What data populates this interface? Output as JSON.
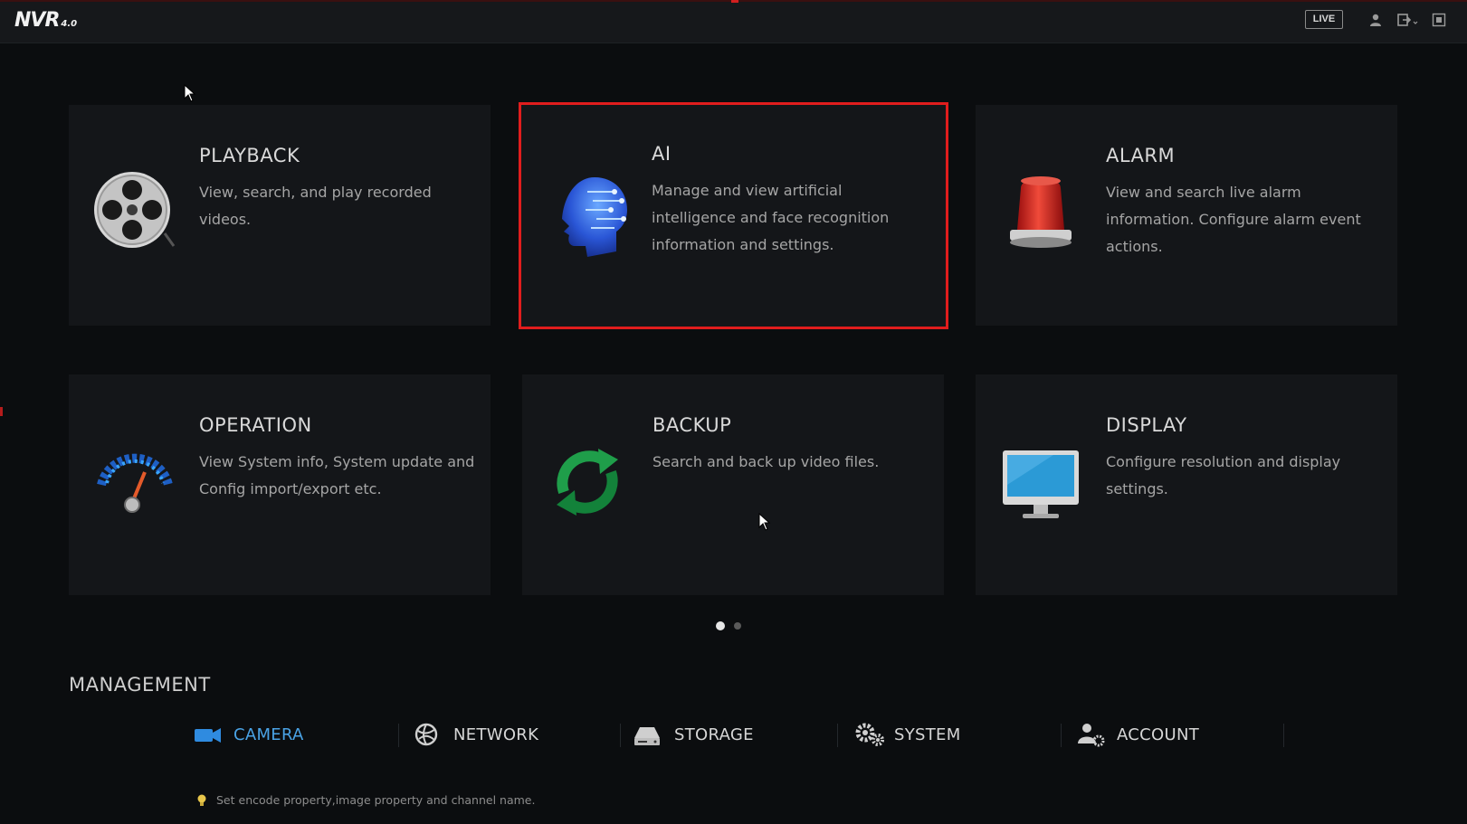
{
  "topbar": {
    "logo_text": "NVR",
    "logo_version": "4.0",
    "live_label": "LIVE",
    "icons": [
      "user-icon",
      "logout-icon",
      "fullscreen-icon"
    ]
  },
  "tiles": [
    {
      "title": "PLAYBACK",
      "desc": "View, search, and play recorded videos.",
      "icon": "film-reel-icon"
    },
    {
      "title": "AI",
      "desc": "Manage and view artificial intelligence and face recognition information and settings.",
      "icon": "ai-head-icon",
      "selected": true
    },
    {
      "title": "ALARM",
      "desc": "View and search live alarm information. Configure alarm event actions.",
      "icon": "alarm-light-icon"
    },
    {
      "title": "OPERATION",
      "desc": "View System info, System update and Config import/export etc.",
      "icon": "gauge-icon"
    },
    {
      "title": "BACKUP",
      "desc": "Search and back up video files.",
      "icon": "refresh-icon"
    },
    {
      "title": "DISPLAY",
      "desc": "Configure resolution and display settings.",
      "icon": "monitor-icon"
    }
  ],
  "pager": {
    "current": 1,
    "total": 2
  },
  "management": {
    "title": "MANAGEMENT",
    "items": [
      {
        "label": "CAMERA",
        "icon": "camera-icon",
        "active": true
      },
      {
        "label": "NETWORK",
        "icon": "globe-icon"
      },
      {
        "label": "STORAGE",
        "icon": "hdd-icon"
      },
      {
        "label": "SYSTEM",
        "icon": "gears-icon"
      },
      {
        "label": "ACCOUNT",
        "icon": "user-settings-icon"
      }
    ],
    "hint": "Set encode property,image property and channel name."
  },
  "colors": {
    "selection_border": "#e01d1d",
    "active_accent": "#4aa3e6",
    "tile_bg": "#141619",
    "page_bg": "#0b0d0f"
  }
}
